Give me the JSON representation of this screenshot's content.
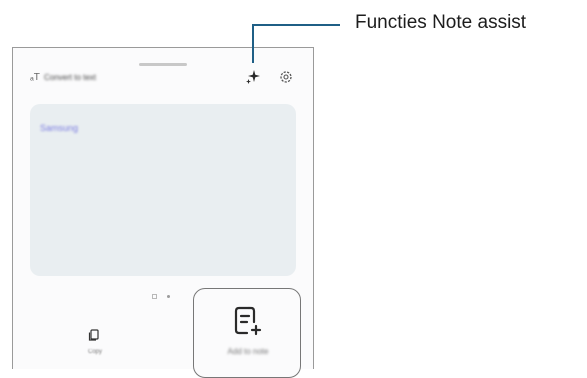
{
  "sheet": {
    "title": "Convert to text",
    "result_text": "Samsung",
    "actions": {
      "copy_label": "Copy",
      "add_note_label": "Add to note"
    }
  },
  "icons": {
    "title": "convert-text-icon",
    "assist": "sparkle-icon",
    "settings": "gear-icon",
    "copy": "copy-icon",
    "add_note": "note-add-icon"
  },
  "callout": {
    "label": "Functies Note assist",
    "line_color": "#1f5f86"
  },
  "colors": {
    "result_background": "#e9eef1",
    "result_text": "#7c7de0"
  }
}
